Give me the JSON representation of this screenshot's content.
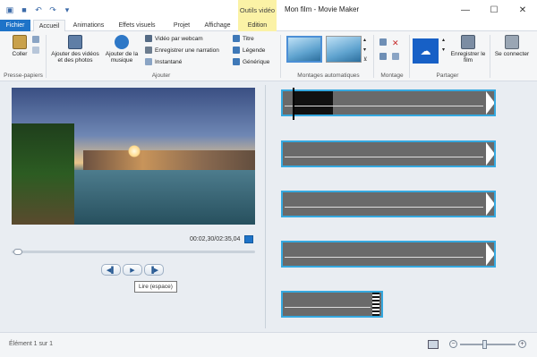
{
  "app": {
    "title": "Mon film - Movie Maker",
    "contextual_group": "Outils vidéo"
  },
  "qat": {
    "icons": [
      "film-icon",
      "save-icon",
      "undo-icon",
      "redo-icon",
      "dropdown-icon"
    ]
  },
  "window_controls": [
    "minimize",
    "maximize",
    "close"
  ],
  "tabs": [
    {
      "label": "Fichier"
    },
    {
      "label": "Accueil"
    },
    {
      "label": "Animations"
    },
    {
      "label": "Effets visuels"
    },
    {
      "label": "Projet"
    },
    {
      "label": "Affichage"
    },
    {
      "label": "Edition"
    }
  ],
  "ribbon": {
    "clipboard": {
      "paste": "Coller",
      "group": "Presse-papiers"
    },
    "add": {
      "add_videos": "Ajouter des vidéos et des photos",
      "add_music": "Ajouter de la musique",
      "webcam": "Vidéo par webcam",
      "narration": "Enregistrer une narration",
      "snapshot": "Instantané",
      "title": "Titre",
      "caption": "Légende",
      "credits": "Générique",
      "group": "Ajouter"
    },
    "auto_montage": {
      "group": "Montages automatiques"
    },
    "montage": {
      "group": "Montage"
    },
    "share": {
      "save_movie": "Enregistrer le film",
      "sign_in": "Se connecter",
      "group": "Partager"
    }
  },
  "player": {
    "timecode": "00:02,30/02:35,04",
    "seek_fraction": 0.016,
    "controls": [
      "previous-frame",
      "play",
      "next-frame"
    ],
    "tooltip": "Lire (espace)"
  },
  "storyboard": {
    "clip_count": 5
  },
  "status": {
    "text": "Élément 1 sur 1",
    "zoom_fraction": 0.45
  },
  "colors": {
    "accent": "#1e73c8",
    "clip_border": "#35a8df",
    "contextual_tab": "#fbf2a6"
  }
}
